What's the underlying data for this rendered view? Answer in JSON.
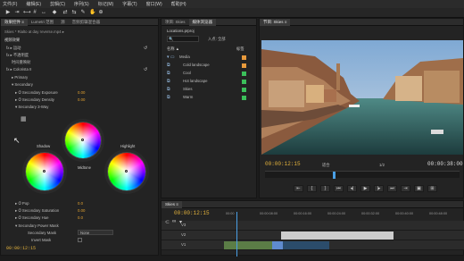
{
  "menu": [
    "文件(F)",
    "编辑(E)",
    "剪辑(C)",
    "序列(S)",
    "标记(M)",
    "字幕(T)",
    "窗口(W)",
    "帮助(H)"
  ],
  "effect_controls": {
    "tabs": [
      "效果控件 ≡",
      "Lumetri 范围",
      "源",
      "音频剪辑混合器"
    ],
    "clip_title": "Skies * Rialto at day reverse.mp4 ▸",
    "section": "视频效果",
    "fx_motion": "fx ▸ 运动",
    "fx_opacity": "fx ▸ 不透明度",
    "fx_time": "时间重映射",
    "fx_colorista": "fx ▸ Colorista II",
    "primary": "▸ Primary",
    "secondary": "▾ Secondary",
    "sec_exposure_label": "▸ ⏱ Secondary Exposure",
    "sec_exposure_val": "0.00",
    "sec_density_label": "▸ ⏱ Secondary Density",
    "sec_density_val": "0.00",
    "sec_3way": "▾ Secondary 3-Way",
    "wheel_shadow": "Shadow",
    "wheel_midtone": "Midtone",
    "wheel_highlight": "Highlight",
    "pop_label": "▸ ⏱ Pop",
    "pop_val": "0.0",
    "sat_label": "▸ ⏱ Secondary Saturation",
    "sat_val": "0.00",
    "hue_label": "▸ ⏱ Secondary Hue",
    "hue_val": "0.0",
    "power_mask": "▾ Secondary Power Mask",
    "mask_label": "Secondary Mask",
    "mask_val": "None",
    "invert_mask": "Invert Mask",
    "footer_time": "00:00:12:15"
  },
  "project": {
    "tabs": [
      "项目: Skies",
      "媒体浏览器",
      "信息",
      "效果",
      "标记",
      "历史记录"
    ],
    "title": "Locations.prproj",
    "search_placeholder": "🔍",
    "in_label": "入点: 全部",
    "col_name": "名称 ▲",
    "col_label": "标签",
    "items": [
      {
        "name": "Media",
        "color": "#e89a3c"
      },
      {
        "name": "Cold landscape",
        "color": "#e89a3c"
      },
      {
        "name": "Cool",
        "color": "#3bbf5a"
      },
      {
        "name": "Hot landscape",
        "color": "#3bbf5a"
      },
      {
        "name": "Skies",
        "color": "#3bbf5a"
      },
      {
        "name": "Warm",
        "color": "#3bbf5a"
      }
    ]
  },
  "program": {
    "tab": "节目: Skies ≡",
    "timecode_left": "00:00:12:15",
    "fit": "适合",
    "fraction": "1/2",
    "timecode_right": "00:00:38:00",
    "transport": [
      "⇤",
      "{",
      "}",
      "⏮",
      "◂|",
      "▶",
      "|▸",
      "⏭",
      "⇥",
      "▣",
      "⊞"
    ]
  },
  "timeline": {
    "tab": "Skies ≡",
    "timecode": "00:00:12:15",
    "ruler": [
      "00:00",
      "00:00:08:00",
      "00:00:16:00",
      "00:00:24:00",
      "00:00:32:00",
      "00:00:40:00",
      "00:00:48:00"
    ],
    "tracks": [
      "V3",
      "V2",
      "V1"
    ]
  },
  "colors": {
    "accent": "#e3b23c",
    "link": "#6aa3e0"
  }
}
